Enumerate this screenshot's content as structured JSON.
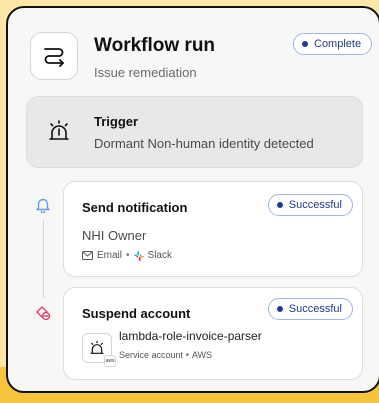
{
  "workflow": {
    "title": "Workflow run",
    "subtitle": "Issue remediation",
    "status": "Complete",
    "icon": "route-icon"
  },
  "trigger": {
    "label": "Trigger",
    "description": "Dormant Non-human identity detected",
    "icon": "alarm-icon"
  },
  "steps": [
    {
      "title": "Send notification",
      "status": "Successful",
      "recipient": "NHI Owner",
      "channels": [
        "Email",
        "Slack"
      ],
      "timeline_icon": "bell-icon",
      "timeline_color": "#6b9bf0"
    },
    {
      "title": "Suspend account",
      "status": "Successful",
      "account_name": "lambda-role-invoice-parser",
      "account_type": "Service account",
      "account_provider": "AWS",
      "badge": "aws",
      "timeline_icon": "user-blocked-icon",
      "timeline_color": "#e0416a"
    }
  ],
  "colors": {
    "background": "#fce7a6",
    "accent_yellow": "#f5c43a",
    "pill_text": "#1f3b8f",
    "pill_border": "#9fb6ee"
  }
}
